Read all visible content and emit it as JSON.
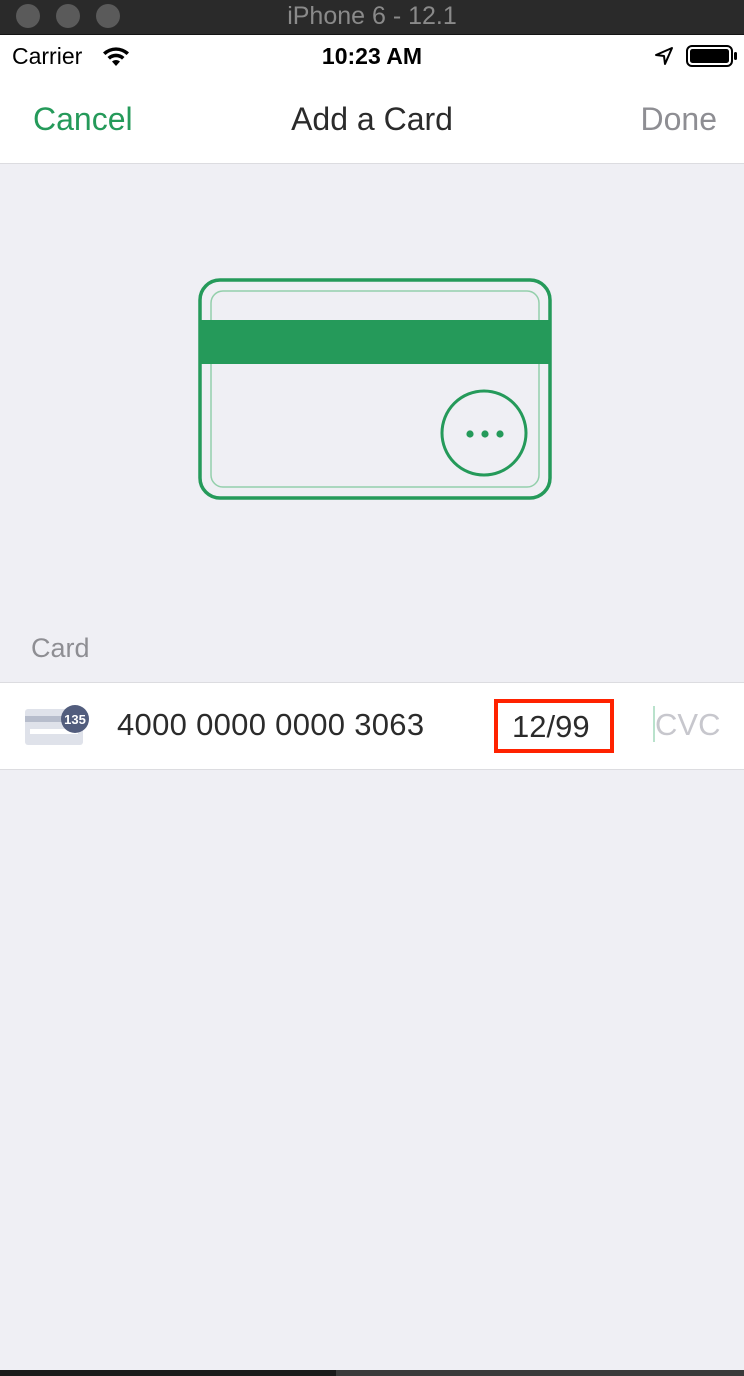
{
  "simulator": {
    "title": "iPhone 6 - 12.1"
  },
  "status_bar": {
    "carrier": "Carrier",
    "time": "10:23 AM",
    "icons": [
      "wifi-icon",
      "location-icon",
      "battery-icon"
    ]
  },
  "nav": {
    "cancel_label": "Cancel",
    "title": "Add a Card",
    "done_label": "Done"
  },
  "illustration": {
    "icon": "credit-card-back-icon"
  },
  "form": {
    "section_label": "Card",
    "brand_icon": "generic-card-icon",
    "brand_badge": "135",
    "card_number": "4000 0000 0000 3063",
    "expiry": "12/99",
    "cvc_placeholder": "CVC"
  },
  "colors": {
    "accent": "#259a5a",
    "highlight": "#ff2200",
    "disabled": "#8e8e93",
    "background": "#efeff4"
  }
}
